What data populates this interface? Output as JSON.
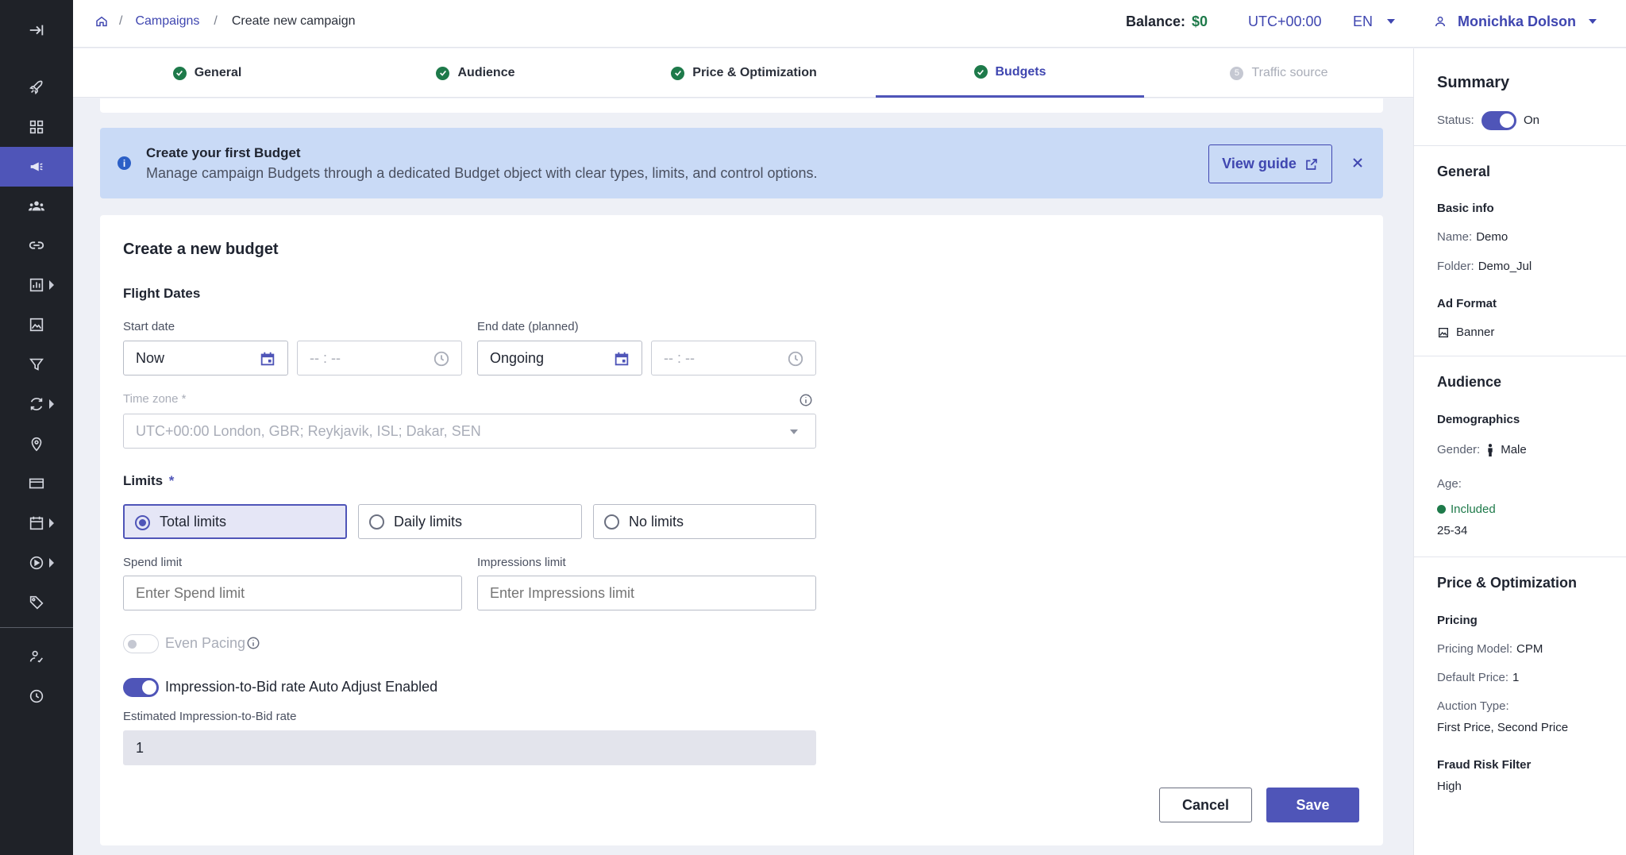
{
  "breadcrumb": {
    "home_icon": "home-icon",
    "sep1": "/",
    "campaigns": "Campaigns",
    "sep2": "/",
    "current": "Create new campaign"
  },
  "header": {
    "balance_label": "Balance:",
    "balance_value": "$0",
    "timezone": "UTC+00:00",
    "language": "EN",
    "user_name": "Monichka Dolson"
  },
  "steps": [
    {
      "label": "General",
      "state": "done"
    },
    {
      "label": "Audience",
      "state": "done"
    },
    {
      "label": "Price & Optimization",
      "state": "done"
    },
    {
      "label": "Budgets",
      "state": "active"
    },
    {
      "label": "Traffic source",
      "state": "disabled",
      "number": "5"
    }
  ],
  "banner": {
    "title": "Create your first Budget",
    "text": "Manage campaign Budgets through a dedicated Budget object with clear types, limits, and control options.",
    "guide_label": "View guide"
  },
  "form": {
    "title": "Create a new budget",
    "flight_dates_heading": "Flight Dates",
    "start_date_label": "Start date",
    "start_date_value": "Now",
    "start_time_placeholder": "--  :  --",
    "end_date_label": "End date (planned)",
    "end_date_value": "Ongoing",
    "end_time_placeholder": "--  :  --",
    "timezone_label": "Time zone *",
    "timezone_value": "UTC+00:00 London, GBR; Reykjavik, ISL; Dakar, SEN",
    "limits_heading": "Limits",
    "limits_required": "*",
    "limit_options": [
      "Total limits",
      "Daily limits",
      "No limits"
    ],
    "selected_limit": "Total limits",
    "spend_limit_label": "Spend limit",
    "spend_limit_placeholder": "Enter Spend limit",
    "impressions_limit_label": "Impressions limit",
    "impressions_limit_placeholder": "Enter Impressions limit",
    "even_pacing_label": "Even Pacing",
    "auto_adjust_label": "Impression-to-Bid rate Auto Adjust Enabled",
    "estimated_rate_label": "Estimated Impression-to-Bid rate",
    "estimated_rate_value": "1",
    "cancel_label": "Cancel",
    "save_label": "Save"
  },
  "summary": {
    "title": "Summary",
    "status_label": "Status:",
    "status_value": "On",
    "general_heading": "General",
    "basic_info": "Basic info",
    "name_label": "Name:",
    "name_value": "Demo",
    "folder_label": "Folder:",
    "folder_value": "Demo_Jul",
    "ad_format_heading": "Ad Format",
    "ad_format_value": "Banner",
    "audience_heading": "Audience",
    "demographics": "Demographics",
    "gender_label": "Gender:",
    "gender_value": "Male",
    "age_label": "Age:",
    "age_status": "Included",
    "age_value": "25-34",
    "price_heading": "Price & Optimization",
    "pricing": "Pricing",
    "pricing_model_label": "Pricing Model:",
    "pricing_model_value": "CPM",
    "default_price_label": "Default Price:",
    "default_price_value": "1",
    "auction_type_label": "Auction Type:",
    "auction_type_value": "First Price, Second Price",
    "fraud_heading": "Fraud Risk Filter",
    "fraud_value": "High"
  },
  "colors": {
    "accent": "#4f55b8",
    "success": "#1e7a4a",
    "banner_bg": "#c9daf6",
    "sidebar_bg": "#1f2228"
  }
}
